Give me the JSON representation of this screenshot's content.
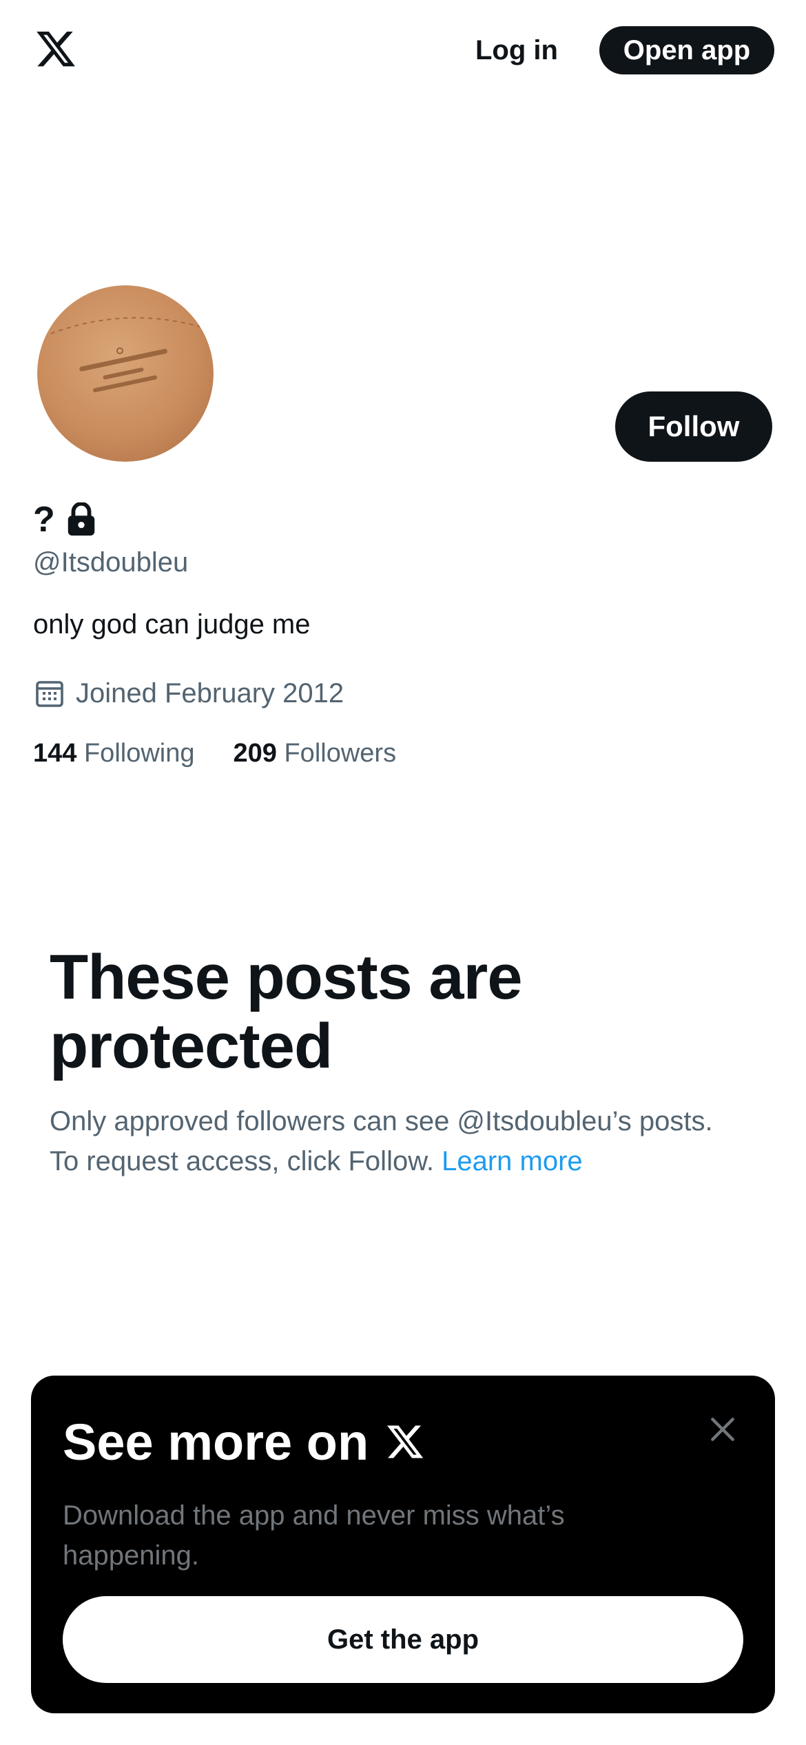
{
  "header": {
    "logo_icon": "x-logo-icon",
    "login_label": "Log in",
    "open_app_label": "Open app"
  },
  "profile": {
    "avatar_icon": "avatar-image",
    "follow_label": "Follow",
    "display_name": "?",
    "lock_icon": "lock-icon",
    "handle": "@Itsdoubleu",
    "bio": "only god can judge me",
    "calendar_icon": "calendar-icon",
    "joined": "Joined February 2012",
    "following_count": "144",
    "following_label": "Following",
    "followers_count": "209",
    "followers_label": "Followers"
  },
  "protected": {
    "title": "These posts are protected",
    "description": "Only approved followers can see @Itsdoubleu’s posts. To request access, click Follow.",
    "learn_more": "Learn more"
  },
  "promo": {
    "title": "See more on",
    "logo_icon": "x-logo-icon",
    "close_icon": "close-icon",
    "description": "Download the app and never miss what’s happening.",
    "cta_label": "Get the app"
  },
  "colors": {
    "text_primary": "#0f1419",
    "text_secondary": "#536471",
    "link": "#1d9bf0",
    "button_dark": "#0f1419",
    "promo_bg": "#000000"
  }
}
